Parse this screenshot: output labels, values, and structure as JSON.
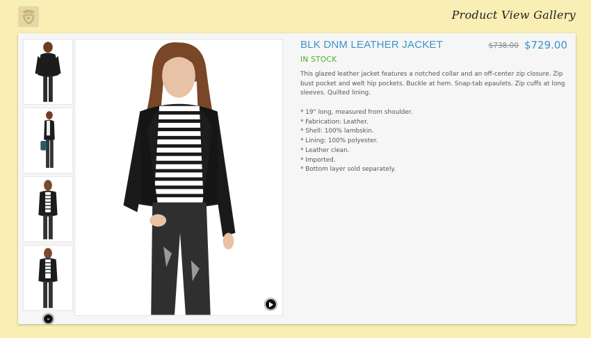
{
  "header": {
    "logo_icon": "brand-logo-icon",
    "title": "Product View Gallery"
  },
  "gallery": {
    "thumbnails": [
      "back view",
      "side view with bag",
      "front view",
      "front view full"
    ],
    "scroll_icon": "chevron-down-icon",
    "play_icon": "play-icon"
  },
  "product": {
    "name": "BLK DNM LEATHER JACKET",
    "old_price": "$738.00",
    "price": "$729.00",
    "stock_status": "IN STOCK",
    "description": "This glazed leather jacket features a notched collar and an off-center zip closure. Zip bust pocket and welt hip pockets. Buckle at hem. Snap-tab epaulets. Zip cuffs at long sleeves. Quilted lining.",
    "features": [
      "* 19\" long, measured from shoulder.",
      "* Fabrication: Leather.",
      "* Shell: 100% lambskin.",
      "* Lining: 100% polyester.",
      "* Leather clean.",
      "* Imported.",
      "* Bottom layer sold separately."
    ]
  },
  "colors": {
    "background": "#f9eeb4",
    "accent": "#3a93c6",
    "in_stock": "#4caf26"
  }
}
